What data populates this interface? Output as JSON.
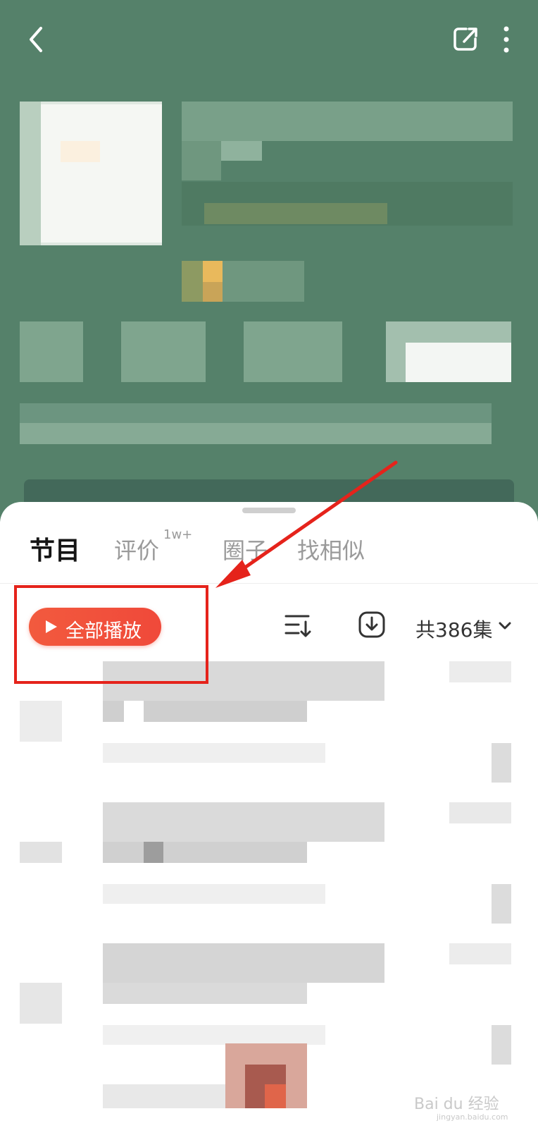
{
  "colors": {
    "header_bg": "#55816a",
    "accent_red": "#f0493a",
    "annotation_red": "#e5231b"
  },
  "header": {
    "back_icon": "back-arrow-icon",
    "share_icon": "share-icon",
    "more_icon": "more-vertical-icon"
  },
  "tabs": [
    {
      "label": "节目",
      "active": true
    },
    {
      "label": "评价",
      "badge": "1w+",
      "active": false
    },
    {
      "label": "圈子",
      "active": false
    },
    {
      "label": "找相似",
      "active": false
    }
  ],
  "toolbar": {
    "play_all_label": "全部播放",
    "play_icon": "play-icon",
    "sort_icon": "sort-icon",
    "download_icon": "download-icon",
    "episode_count": "共386集",
    "chevron_icon": "chevron-down-icon"
  },
  "watermark": {
    "text": "Bai du 经验",
    "url": "jingyan.baidu.com"
  }
}
